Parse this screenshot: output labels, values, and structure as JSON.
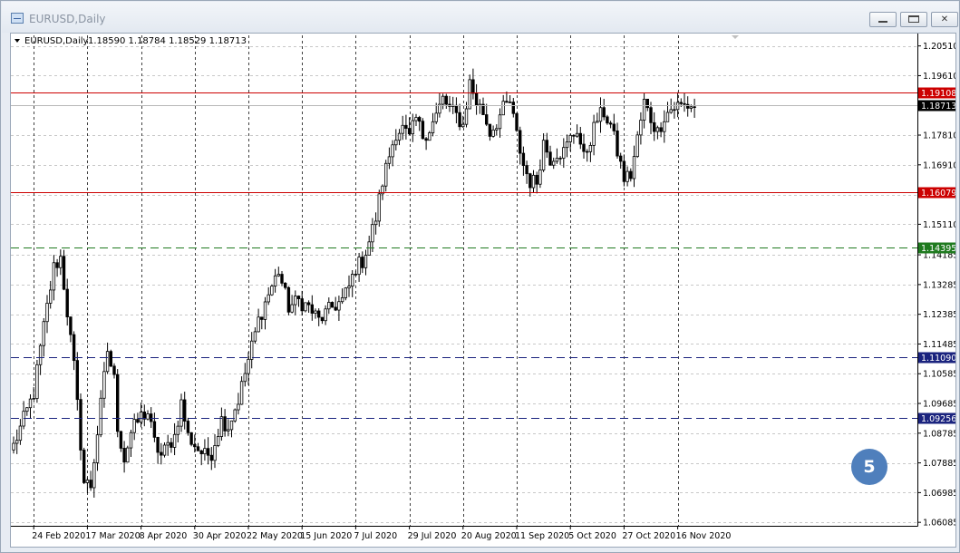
{
  "window": {
    "title": "EURUSD,Daily",
    "buttons": {
      "minimize": "minimize-button",
      "maximize": "maximize-button",
      "close": "✕"
    }
  },
  "badge": {
    "text": "5"
  },
  "chart_data": {
    "type": "candlestick",
    "header": {
      "symbol": "EURUSD,Daily",
      "ohlc_text": "1.18590 1.18784 1.18529 1.18713"
    },
    "ylim": [
      1.0598,
      1.2083
    ],
    "y_ticks": [
      "1.20510",
      "1.19610",
      "1.18710",
      "1.17810",
      "1.16910",
      "1.16010",
      "1.15110",
      "1.14185",
      "1.13285",
      "1.12385",
      "1.11485",
      "1.10585",
      "1.09685",
      "1.08785",
      "1.07885",
      "1.06985",
      "1.06085"
    ],
    "x_tick_labels": [
      "24 Feb 2020",
      "17 Mar 2020",
      "8 Apr 2020",
      "30 Apr 2020",
      "22 May 2020",
      "15 Jun 2020",
      "7 Jul 2020",
      "29 Jul 2020",
      "20 Aug 2020",
      "11 Sep 2020",
      "5 Oct 2020",
      "27 Oct 2020",
      "16 Nov 2020"
    ],
    "x_tick_index": [
      6,
      22,
      38,
      54,
      70,
      86,
      102,
      118,
      134,
      150,
      166,
      182,
      198
    ],
    "levels": [
      {
        "value": "1.19108",
        "color": "#cc0000",
        "style": "solid"
      },
      {
        "value": "1.16079",
        "color": "#cc0000",
        "style": "solid"
      },
      {
        "value": "1.14395",
        "color": "#1f7a1f",
        "style": "dashed"
      },
      {
        "value": "1.11090",
        "color": "#1a237e",
        "style": "dashed"
      },
      {
        "value": "1.09256",
        "color": "#1a237e",
        "style": "dashed"
      }
    ],
    "current_price": "1.18713",
    "anchors": [
      [
        0,
        1.084
      ],
      [
        6,
        1.1
      ],
      [
        9,
        1.12
      ],
      [
        12,
        1.138
      ],
      [
        14,
        1.141
      ],
      [
        18,
        1.108
      ],
      [
        21,
        1.073
      ],
      [
        23,
        1.072
      ],
      [
        25,
        1.088
      ],
      [
        28,
        1.113
      ],
      [
        30,
        1.104
      ],
      [
        31,
        1.09
      ],
      [
        33,
        1.08
      ],
      [
        35,
        1.088
      ],
      [
        38,
        1.093
      ],
      [
        40,
        1.094
      ],
      [
        42,
        1.085
      ],
      [
        44,
        1.081
      ],
      [
        46,
        1.084
      ],
      [
        48,
        1.087
      ],
      [
        50,
        1.097
      ],
      [
        52,
        1.087
      ],
      [
        55,
        1.083
      ],
      [
        57,
        1.081
      ],
      [
        59,
        1.082
      ],
      [
        62,
        1.092
      ],
      [
        64,
        1.09
      ],
      [
        67,
        1.098
      ],
      [
        70,
        1.11
      ],
      [
        73,
        1.122
      ],
      [
        76,
        1.13
      ],
      [
        79,
        1.137
      ],
      [
        82,
        1.126
      ],
      [
        85,
        1.128
      ],
      [
        88,
        1.126
      ],
      [
        91,
        1.122
      ],
      [
        93,
        1.124
      ],
      [
        95,
        1.126
      ],
      [
        98,
        1.128
      ],
      [
        100,
        1.132
      ],
      [
        102,
        1.138
      ],
      [
        104,
        1.14
      ],
      [
        106,
        1.146
      ],
      [
        108,
        1.153
      ],
      [
        110,
        1.164
      ],
      [
        112,
        1.172
      ],
      [
        114,
        1.179
      ],
      [
        116,
        1.18
      ],
      [
        118,
        1.177
      ],
      [
        120,
        1.183
      ],
      [
        122,
        1.178
      ],
      [
        124,
        1.18
      ],
      [
        126,
        1.184
      ],
      [
        128,
        1.189
      ],
      [
        130,
        1.186
      ],
      [
        132,
        1.184
      ],
      [
        134,
        1.181
      ],
      [
        136,
        1.194
      ],
      [
        138,
        1.188
      ],
      [
        140,
        1.185
      ],
      [
        142,
        1.179
      ],
      [
        144,
        1.182
      ],
      [
        146,
        1.186
      ],
      [
        148,
        1.188
      ],
      [
        150,
        1.178
      ],
      [
        152,
        1.169
      ],
      [
        154,
        1.164
      ],
      [
        156,
        1.164
      ],
      [
        158,
        1.176
      ],
      [
        160,
        1.171
      ],
      [
        162,
        1.173
      ],
      [
        164,
        1.173
      ],
      [
        166,
        1.177
      ],
      [
        168,
        1.18
      ],
      [
        170,
        1.171
      ],
      [
        172,
        1.177
      ],
      [
        174,
        1.183
      ],
      [
        176,
        1.185
      ],
      [
        178,
        1.181
      ],
      [
        180,
        1.173
      ],
      [
        182,
        1.165
      ],
      [
        184,
        1.166
      ],
      [
        186,
        1.177
      ],
      [
        188,
        1.188
      ],
      [
        190,
        1.183
      ],
      [
        192,
        1.179
      ],
      [
        194,
        1.184
      ],
      [
        196,
        1.186
      ],
      [
        198,
        1.187
      ],
      [
        200,
        1.187
      ],
      [
        202,
        1.187
      ]
    ]
  }
}
